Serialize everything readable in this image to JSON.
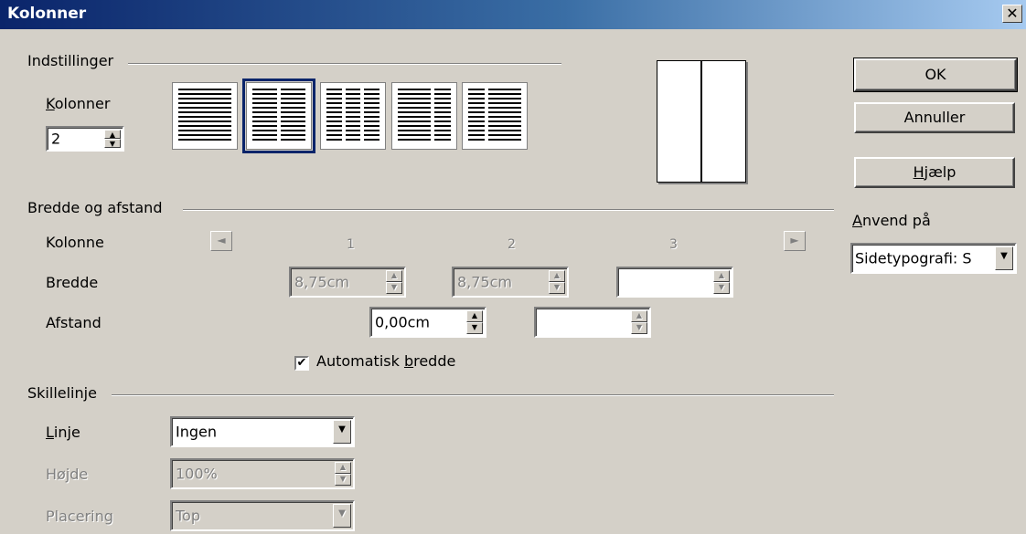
{
  "window": {
    "title": "Kolonner",
    "close_label": "✕"
  },
  "settings": {
    "group_title": "Indstillinger",
    "columns_label": "Kolonner",
    "columns_value": "2",
    "preset_icons": [
      "one-column-icon",
      "two-column-icon",
      "three-column-icon",
      "two-column-left-wide-icon",
      "two-column-right-wide-icon"
    ]
  },
  "buttons": {
    "ok": "OK",
    "cancel": "Annuller",
    "help": "Hjælp"
  },
  "apply": {
    "label": "Anvend på",
    "value": "Sidetypografi: S"
  },
  "width_spacing": {
    "group_title": "Bredde og afstand",
    "column_label": "Kolonne",
    "width_label": "Bredde",
    "spacing_label": "Afstand",
    "col_numbers": [
      "1",
      "2",
      "3"
    ],
    "widths": [
      "8,75cm",
      "8,75cm",
      ""
    ],
    "spacings": [
      "0,00cm",
      ""
    ],
    "auto_width_label": "Automatisk bredde",
    "auto_width_checked": "✔"
  },
  "separator": {
    "group_title": "Skillelinje",
    "line_label": "Linje",
    "line_value": "Ingen",
    "height_label": "Højde",
    "height_value": "100%",
    "position_label": "Placering",
    "position_value": "Top"
  },
  "colors": {
    "title_start": "#0a246a",
    "title_end": "#a6caf0",
    "face": "#d4d0c8"
  }
}
